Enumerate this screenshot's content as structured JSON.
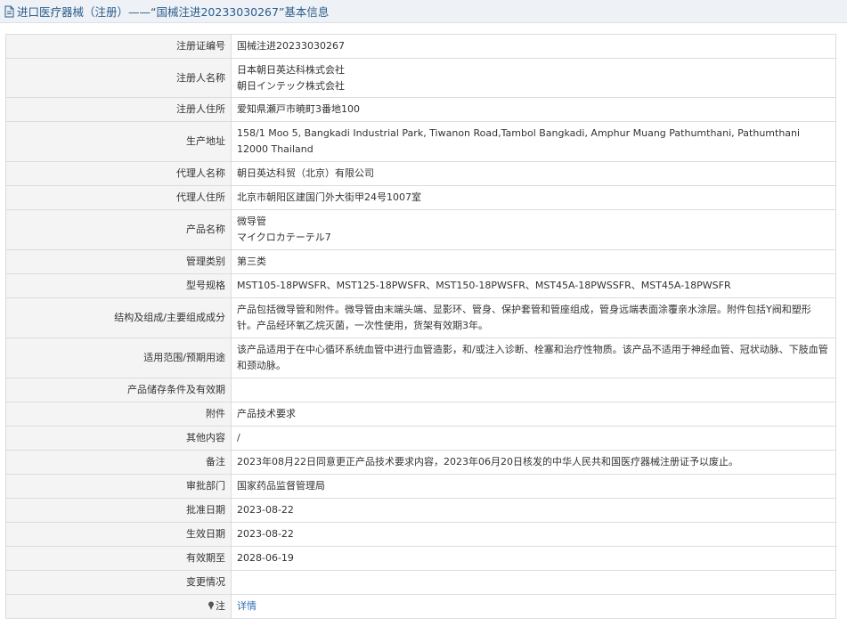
{
  "header": {
    "prefix": "进口医疗器械（注册）——“国械注进20233030267”基本信息"
  },
  "rows": [
    {
      "label": "注册证编号",
      "values": [
        "国械注进20233030267"
      ],
      "h": 27
    },
    {
      "label": "注册人名称",
      "values": [
        "日本朝日英达科株式会社",
        "朝日インテック株式会社"
      ],
      "h": 44
    },
    {
      "label": "注册人住所",
      "values": [
        "爱知県瀬戸市暁町3番地100"
      ],
      "h": 27
    },
    {
      "label": "生产地址",
      "values": [
        "158/1 Moo 5, Bangkadi Industrial Park, Tiwanon Road,Tambol Bangkadi, Amphur Muang Pathumthani, Pathumthani 12000 Thailand"
      ],
      "h": 45
    },
    {
      "label": "代理人名称",
      "values": [
        "朝日英达科贸（北京）有限公司"
      ],
      "h": 27
    },
    {
      "label": "代理人住所",
      "values": [
        "北京市朝阳区建国门外大街甲24号1007室"
      ],
      "h": 27
    },
    {
      "label": "产品名称",
      "values": [
        "微导管",
        "マイクロカテーテル7"
      ],
      "h": 45
    },
    {
      "label": "管理类别",
      "values": [
        "第三类"
      ],
      "h": 27
    },
    {
      "label": "型号规格",
      "values": [
        "MST105-18PWSFR、MST125-18PWSFR、MST150-18PWSFR、MST45A-18PWSSFR、MST45A-18PWSFR"
      ],
      "h": 27
    },
    {
      "label": "结构及组成/主要组成成分",
      "values": [
        "产品包括微导管和附件。微导管由末端头端、显影环、管身、保护套管和管座组成，管身远端表面涂覆亲水涂层。附件包括Y阀和塑形针。产品经环氧乙烷灭菌，一次性使用，货架有效期3年。"
      ],
      "h": 45
    },
    {
      "label": "适用范围/预期用途",
      "values": [
        "该产品适用于在中心循环系统血管中进行血管造影，和/或注入诊断、栓塞和治疗性物质。该产品不适用于神经血管、冠状动脉、下肢血管和颈动脉。"
      ],
      "h": 45
    },
    {
      "label": "产品储存条件及有效期",
      "values": [
        ""
      ],
      "h": 27
    },
    {
      "label": "附件",
      "values": [
        "产品技术要求"
      ],
      "h": 27
    },
    {
      "label": "其他内容",
      "values": [
        "/"
      ],
      "h": 27
    },
    {
      "label": "备注",
      "values": [
        "2023年08月22日同意更正产品技术要求内容，2023年06月20日核发的中华人民共和国医疗器械注册证予以废止。"
      ],
      "h": 27
    },
    {
      "label": "审批部门",
      "values": [
        "国家药品监督管理局"
      ],
      "h": 27
    },
    {
      "label": "批准日期",
      "values": [
        "2023-08-22"
      ],
      "h": 27
    },
    {
      "label": "生效日期",
      "values": [
        "2023-08-22"
      ],
      "h": 27
    },
    {
      "label": "有效期至",
      "values": [
        "2028-06-19"
      ],
      "h": 27
    },
    {
      "label": "变更情况",
      "values": [
        ""
      ],
      "h": 27
    }
  ],
  "footer_row": {
    "label": "注",
    "link_text": "详情"
  },
  "colors": {
    "title": "#2b5d8c",
    "label_bg": "#f4f4f4",
    "border": "#dcdcdc",
    "link": "#2f6fb3"
  }
}
